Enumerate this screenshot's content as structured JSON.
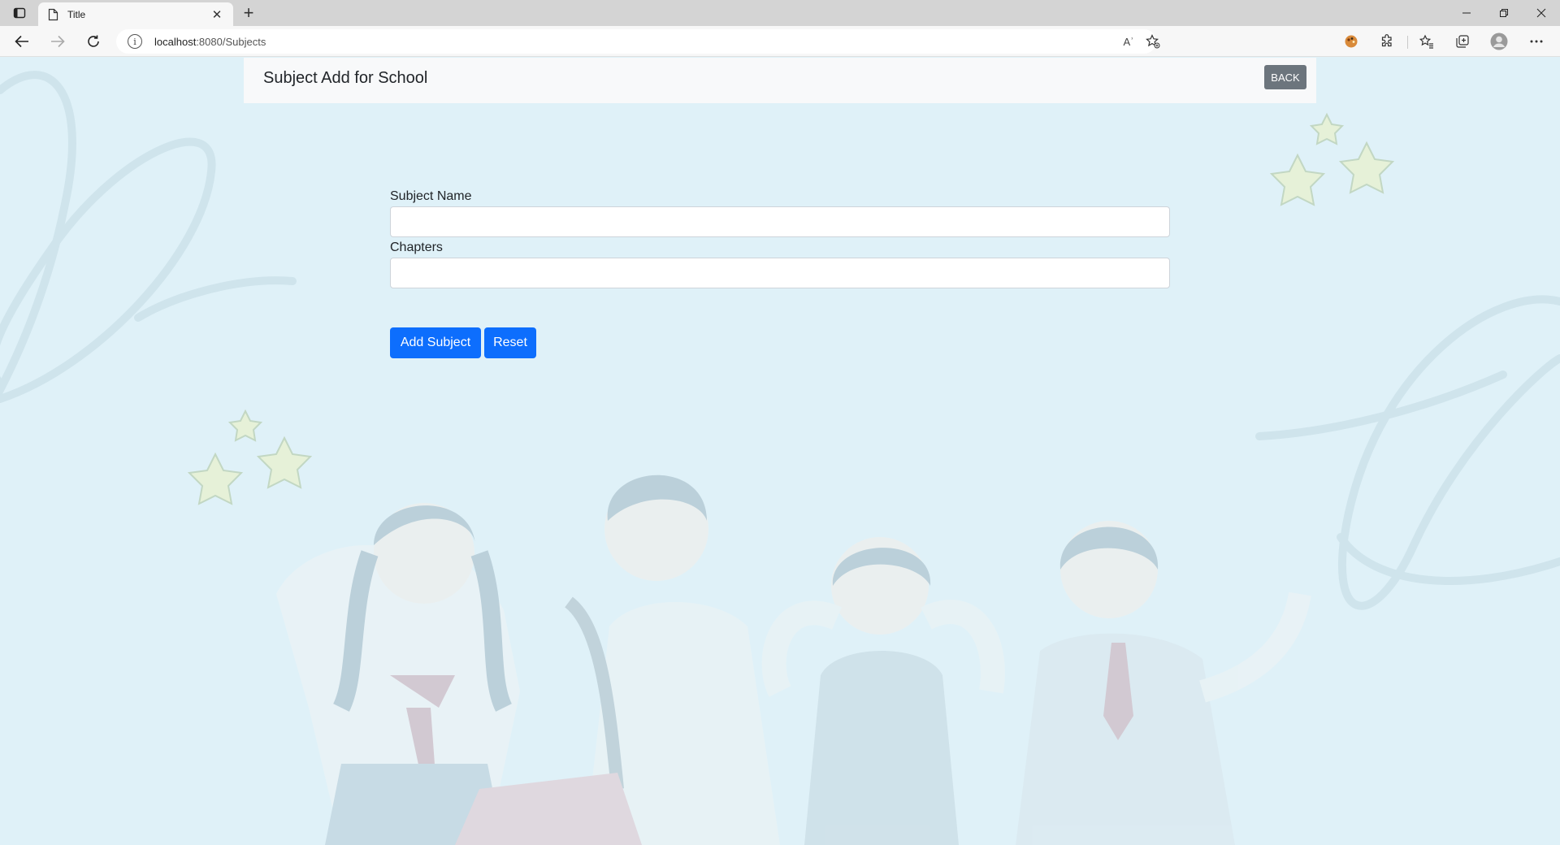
{
  "browser": {
    "tab_title": "Title",
    "url_host": "localhost",
    "url_rest": ":8080/Subjects",
    "reading_mode_glyph": "Aʾ"
  },
  "header": {
    "title": "Subject Add for School",
    "back_label": "BACK"
  },
  "form": {
    "subject_name_label": "Subject Name",
    "subject_name_value": "",
    "chapters_label": "Chapters",
    "chapters_value": "",
    "add_label": "Add Subject",
    "reset_label": "Reset"
  },
  "colors": {
    "page_bg": "#dff1f8",
    "primary": "#0d6efd",
    "secondary": "#6c757d",
    "header_bg": "#f8f9fa"
  },
  "icons": [
    "tab-actions-icon",
    "page-icon",
    "close-icon",
    "plus-icon",
    "minimize-icon",
    "restore-icon",
    "back-arrow-icon",
    "forward-arrow-icon",
    "refresh-icon",
    "info-icon",
    "read-aloud-icon",
    "favorite-add-icon",
    "palette-extension-icon",
    "extensions-icon",
    "favorites-icon",
    "collections-icon",
    "profile-icon",
    "more-icon"
  ]
}
